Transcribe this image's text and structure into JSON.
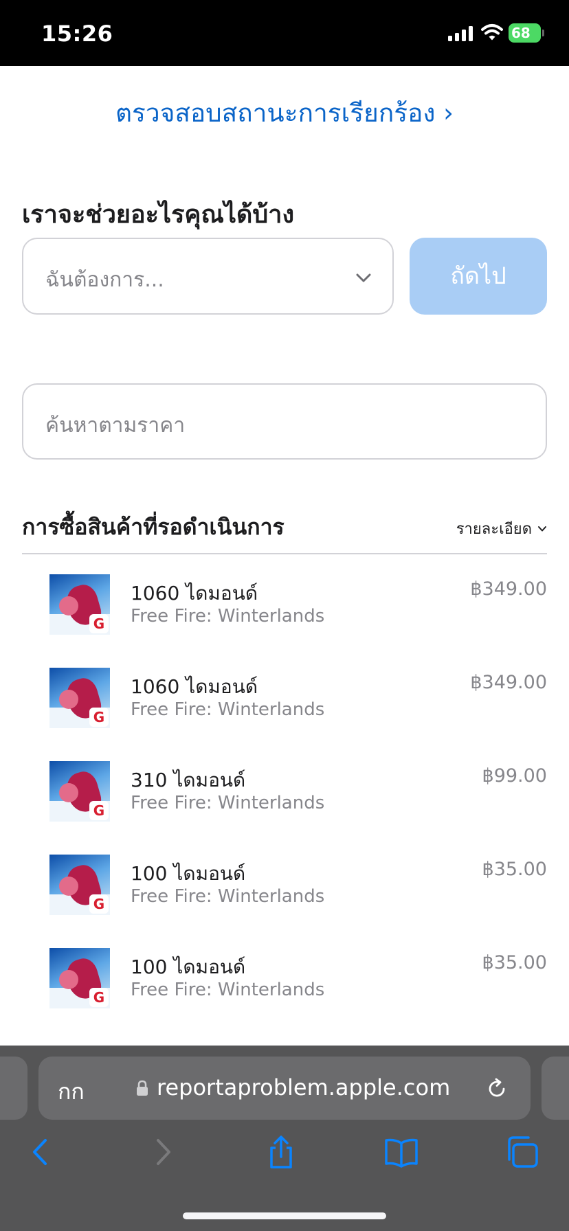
{
  "status_bar": {
    "time": "15:26",
    "battery": "68"
  },
  "main": {
    "status_link": "ตรวจสอบสถานะการเรียกร้อง ›",
    "help_heading": "เราจะช่วยอะไรคุณได้บ้าง",
    "select_placeholder": "ฉันต้องการ...",
    "next_label": "ถัดไป",
    "price_search_placeholder": "ค้นหาตามราคา",
    "pending_title": "การซื้อสินค้าที่รอดำเนินการ",
    "detail_label": "รายละเอียด"
  },
  "purchases": [
    {
      "name": "1060 ไดมอนด์",
      "app": "Free Fire: Winterlands",
      "price": "฿349.00"
    },
    {
      "name": "1060 ไดมอนด์",
      "app": "Free Fire: Winterlands",
      "price": "฿349.00"
    },
    {
      "name": "310 ไดมอนด์",
      "app": "Free Fire: Winterlands",
      "price": "฿99.00"
    },
    {
      "name": "100 ไดมอนด์",
      "app": "Free Fire: Winterlands",
      "price": "฿35.00"
    },
    {
      "name": "100 ไดมอนด์",
      "app": "Free Fire: Winterlands",
      "price": "฿35.00"
    }
  ],
  "browser": {
    "text_size_label": "กก",
    "url": "reportaproblem.apple.com"
  },
  "icons": {
    "status": [
      "cellular-signal-icon",
      "wifi-icon",
      "battery-charging-icon"
    ],
    "toolbar": [
      "back-icon",
      "forward-icon",
      "share-icon",
      "bookmarks-icon",
      "tabs-icon"
    ],
    "misc": [
      "chevron-down-icon",
      "lock-icon",
      "reload-icon"
    ]
  },
  "colors": {
    "link": "#0a64c8",
    "next_button_disabled": "#a9cdf5",
    "battery": "#4cd964",
    "toolbar_bg": "#555556",
    "toolbar_icon": "#0a84ff"
  }
}
